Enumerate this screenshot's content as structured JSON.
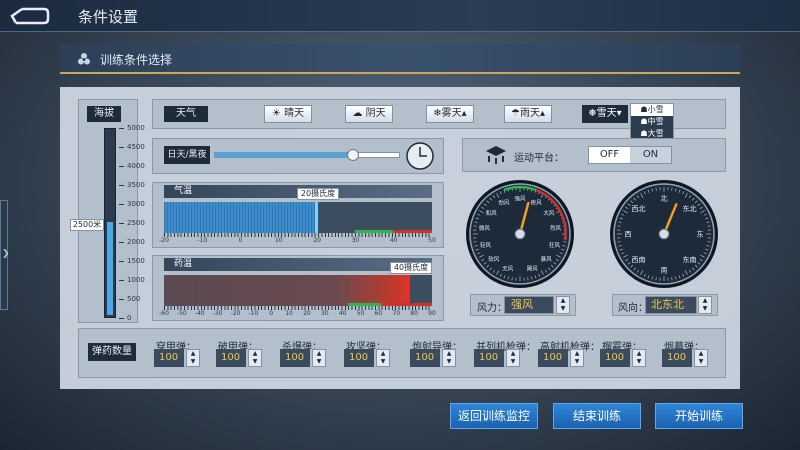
{
  "header": {
    "title": "条件设置"
  },
  "side_tab": {
    "arrow": "❯"
  },
  "section": {
    "title": "训练条件选择"
  },
  "altitude": {
    "label": "海拔",
    "value_label": "2500米",
    "ticks": [
      "5000",
      "4500",
      "4000",
      "3500",
      "3000",
      "2500",
      "2000",
      "1500",
      "1000",
      "500",
      "0"
    ],
    "fill_fraction": 0.5
  },
  "weather": {
    "label": "天气",
    "options": [
      {
        "icon": "☀",
        "label": "晴天"
      },
      {
        "icon": "☁",
        "label": "阴天"
      },
      {
        "icon": "❄",
        "label": "雾天"
      },
      {
        "icon": "☂",
        "label": "雨天"
      },
      {
        "icon": "❅",
        "label": "雪天"
      }
    ],
    "snow_menu": [
      "小雪",
      "中雪",
      "大雪"
    ],
    "selected": "雪天"
  },
  "daynight": {
    "label": "日天/黑夜",
    "slider_fraction": 0.73
  },
  "air_temp": {
    "label": "气温",
    "value": "20摄氏度",
    "ticks": [
      "-20",
      "-10",
      "0",
      "10",
      "20",
      "30",
      "40",
      "50"
    ]
  },
  "charge_temp": {
    "label": "药温",
    "value": "40摄氏度",
    "ticks": [
      "-60",
      "-50",
      "-40",
      "-30",
      "-20",
      "-10",
      "0",
      "10",
      "20",
      "30",
      "40",
      "50",
      "60",
      "70",
      "80",
      "90"
    ]
  },
  "platform": {
    "label": "运动平台：",
    "off": "OFF",
    "on": "ON"
  },
  "wind_force": {
    "label": "风力：",
    "value": "强风",
    "gauge_labels": [
      "无风",
      "软风",
      "轻风",
      "微风",
      "和风",
      "劲风",
      "强风",
      "疾风",
      "大风",
      "烈风",
      "狂风",
      "暴风",
      "飓风"
    ]
  },
  "wind_dir": {
    "label": "风向：",
    "value": "北东北",
    "gauge_labels": [
      "北",
      "东北",
      "东",
      "东南",
      "南",
      "西南",
      "西",
      "西北"
    ]
  },
  "ammo": {
    "label": "弹药数量",
    "items": [
      {
        "label": "穿甲弹：",
        "value": "100"
      },
      {
        "label": "破甲弹：",
        "value": "100"
      },
      {
        "label": "杀爆弹：",
        "value": "100"
      },
      {
        "label": "攻坚弹：",
        "value": "100"
      },
      {
        "label": "炮射导弹：",
        "value": "100"
      },
      {
        "label": "并列机枪弹：",
        "value": "100"
      },
      {
        "label": "高射机枪弹：",
        "value": "100"
      },
      {
        "label": "榴霰弹：",
        "value": "100"
      },
      {
        "label": "烟幕弹：",
        "value": "100"
      }
    ]
  },
  "actions": {
    "back": "返回训练监控",
    "end": "结束训练",
    "start": "开始训练"
  },
  "colors": {
    "accent": "#1a6fd0",
    "gold": "#f3c64c",
    "blue_fill": "#4aa8e8",
    "red": "#d0322a",
    "green": "#2fb64a"
  }
}
